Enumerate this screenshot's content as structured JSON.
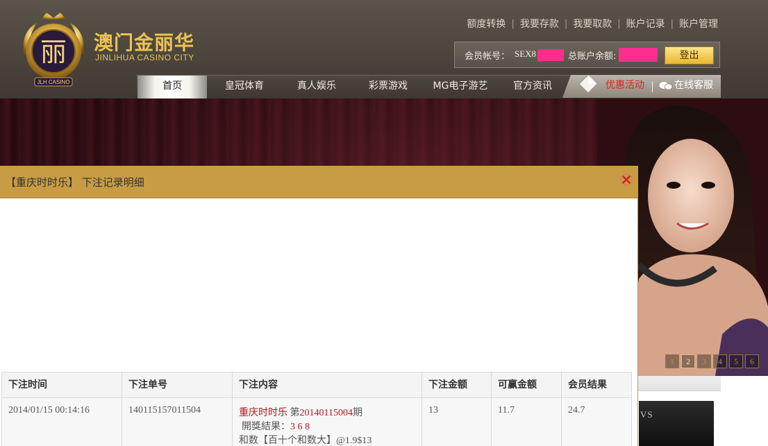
{
  "brand": {
    "logo_cn": "澳门金丽华",
    "logo_en": "JINLIHUA CASINO CITY",
    "badge_char": "丽",
    "badge_text": "JLH CASINO"
  },
  "top_links": [
    "额度转换",
    "我要存款",
    "我要取款",
    "账户记录",
    "账户管理"
  ],
  "account": {
    "member_label": "会员帐号：",
    "member_id": "SEX8",
    "balance_label": "总账户余额:",
    "logout_label": "登出"
  },
  "nav": {
    "items": [
      "首页",
      "皇冠体育",
      "真人娱乐",
      "彩票游戏",
      "MG电子游艺",
      "官方资讯"
    ],
    "active_index": 0,
    "promo_label": "优惠活动",
    "support_label": "在线客服"
  },
  "banner": {
    "pager": [
      "1",
      "2",
      "3",
      "4",
      "5",
      "6"
    ],
    "active_page": "2"
  },
  "side_thumb": {
    "caption": "VS"
  },
  "modal": {
    "title": "【重庆时时乐】 下注记录明细",
    "table": {
      "headers": [
        "下注时间",
        "下注单号",
        "下注内容",
        "下注金额",
        "可赢金额",
        "会员结果"
      ],
      "row": {
        "time": "2014/01/15 00:14:16",
        "order_no": "140115157011504",
        "game": "重庆时时乐",
        "period_prefix": "第",
        "period": "20140115004",
        "period_suffix": "期",
        "result_label": "開獎結果：",
        "result_value": "3 6 8",
        "bet_detail": "和数【百十个和数大】@1.9$13",
        "amount": "13",
        "win_amount": "11.7",
        "result": "24.7"
      }
    }
  },
  "colors": {
    "header_bg": "#4a443b",
    "modal_header": "#c79c44",
    "accent_gold": "#e8c35a",
    "logout_btn": "#f2c94a",
    "mask_pink": "#ff2d8d",
    "red_text": "#b3161b"
  }
}
